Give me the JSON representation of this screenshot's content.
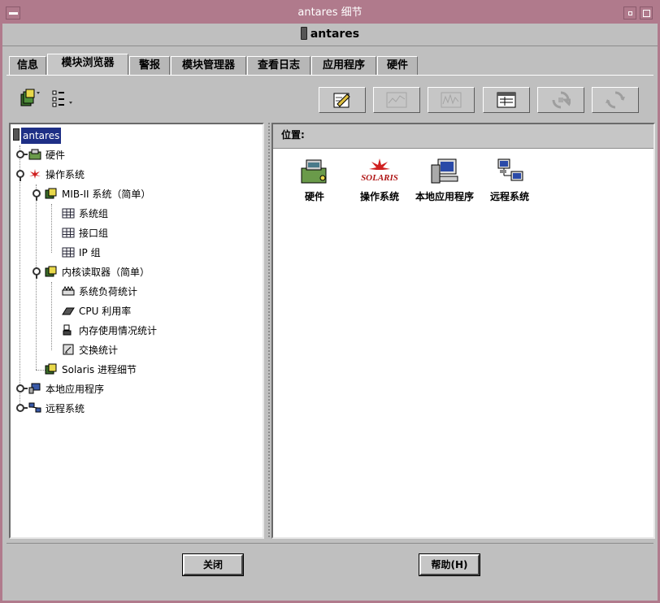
{
  "window": {
    "title": "antares 细节"
  },
  "header": {
    "host": "antares"
  },
  "tabs": [
    {
      "label": "信息"
    },
    {
      "label": "模块浏览器"
    },
    {
      "label": "警报"
    },
    {
      "label": "模块管理器"
    },
    {
      "label": "查看日志"
    },
    {
      "label": "应用程序"
    },
    {
      "label": "硬件"
    }
  ],
  "active_tab": "模块浏览器",
  "tree": {
    "root": "antares",
    "items": [
      {
        "label": "硬件"
      },
      {
        "label": "操作系统"
      },
      {
        "label": "MIB-II 系统（简单）"
      },
      {
        "label": "系统组"
      },
      {
        "label": "接口组"
      },
      {
        "label": "IP 组"
      },
      {
        "label": "内核读取器（简单）"
      },
      {
        "label": "系统负荷统计"
      },
      {
        "label": "CPU 利用率"
      },
      {
        "label": "内存使用情况统计"
      },
      {
        "label": "交换统计"
      },
      {
        "label": "Solaris 进程细节"
      },
      {
        "label": "本地应用程序"
      },
      {
        "label": "远程系统"
      }
    ]
  },
  "location": {
    "label": "位置:"
  },
  "icons": [
    {
      "label": "硬件",
      "icon": "hardware-icon"
    },
    {
      "label": "操作系统",
      "icon": "solaris-icon",
      "logo_text": "SOLARIS"
    },
    {
      "label": "本地应用程序",
      "icon": "local-apps-icon"
    },
    {
      "label": "远程系统",
      "icon": "remote-systems-icon"
    }
  ],
  "buttons": {
    "close": "关闭",
    "help": "帮助(H)"
  },
  "colors": {
    "titlebar": "#b07a8c",
    "selection": "#1e2f86",
    "background": "#bfbfbf"
  }
}
